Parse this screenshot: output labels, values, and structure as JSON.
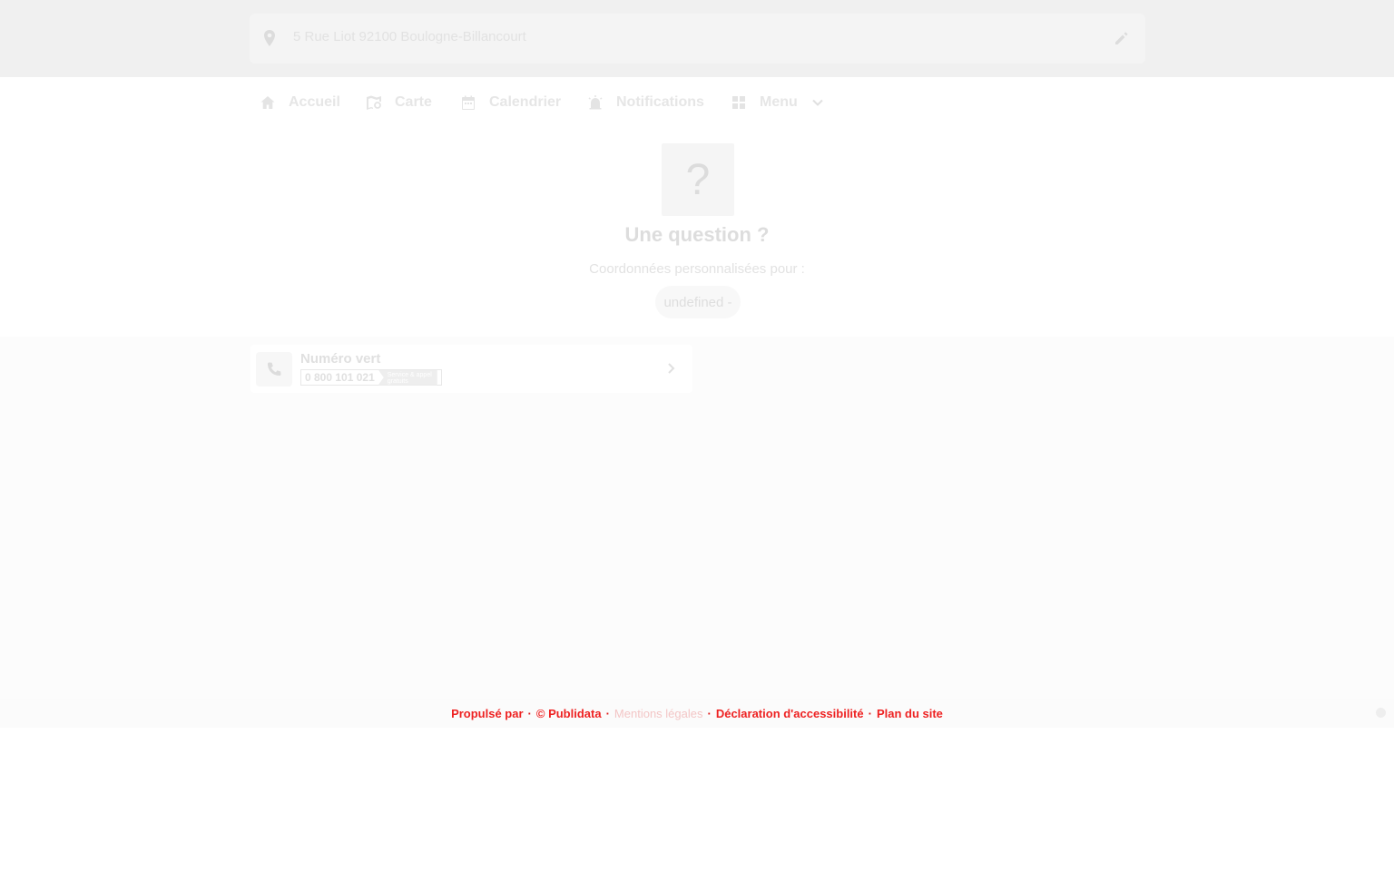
{
  "address": {
    "text": "5 Rue Liot 92100 Boulogne-Billancourt",
    "pin_icon": "map-pin-icon",
    "edit_icon": "pencil-icon"
  },
  "nav": {
    "items": [
      {
        "label": "Accueil",
        "icon": "home-icon"
      },
      {
        "label": "Carte",
        "icon": "map-icon"
      },
      {
        "label": "Calendrier",
        "icon": "calendar-icon"
      },
      {
        "label": "Notifications",
        "icon": "alarm-icon"
      },
      {
        "label": "Menu",
        "icon": "grid-icon"
      }
    ]
  },
  "hero": {
    "icon_glyph": "?",
    "title": "Une question ?",
    "subtitle": "Coordonnées personnalisées pour :",
    "pill": "undefined -"
  },
  "card": {
    "title": "Numéro vert",
    "number": "0 800 101 021",
    "service_line1": "Service & appel",
    "service_line2": "gratuits"
  },
  "footer": {
    "links": [
      "Propulsé par",
      "© Publidata",
      "Mentions légales",
      "Déclaration d'accessibilité",
      "Plan du site"
    ],
    "accent_color": "#ee2222"
  }
}
